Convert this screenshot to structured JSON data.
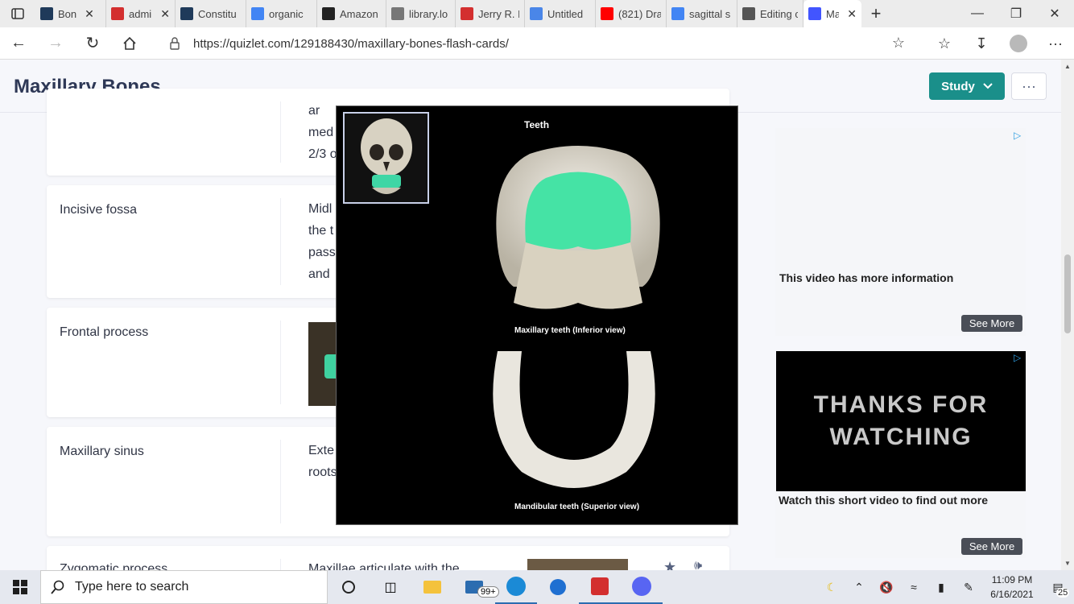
{
  "browser": {
    "tabs": [
      {
        "label": "Bon",
        "icon": "quizlet-dark-icon",
        "color": "#1f3a5a",
        "closable": true
      },
      {
        "label": "admin_a",
        "icon": "pdf-icon",
        "color": "#d32f2f",
        "closable": true
      },
      {
        "label": "Constitu",
        "icon": "quizlet-dark-icon",
        "color": "#1f3a5a",
        "closable": false
      },
      {
        "label": "organic",
        "icon": "google-icon",
        "color": "#4285f4",
        "closable": false
      },
      {
        "label": "Amazon",
        "icon": "amazon-icon",
        "color": "#222222",
        "closable": false
      },
      {
        "label": "library.lo",
        "icon": "page-icon",
        "color": "#777777",
        "closable": false
      },
      {
        "label": "Jerry R. M",
        "icon": "pdf-icon",
        "color": "#d32f2f",
        "closable": false
      },
      {
        "label": "Untitled",
        "icon": "docs-icon",
        "color": "#4a86e8",
        "closable": false
      },
      {
        "label": "(821) Dra",
        "icon": "youtube-icon",
        "color": "#ff0000",
        "closable": false
      },
      {
        "label": "sagittal s",
        "icon": "google-icon",
        "color": "#4285f4",
        "closable": false
      },
      {
        "label": "Editing c",
        "icon": "edit-icon",
        "color": "#555555",
        "closable": false
      },
      {
        "label": "Max",
        "icon": "quizlet-icon",
        "color": "#4255ff",
        "closable": true,
        "active": true
      }
    ],
    "url": "https://quizlet.com/129188430/maxillary-bones-flash-cards/"
  },
  "page": {
    "title": "Maxillary Bones",
    "study_label": "Study",
    "more_label": "···"
  },
  "cards": [
    {
      "term": "",
      "def_lines": [
        "ar",
        "med",
        "2/3 o"
      ]
    },
    {
      "term": "Incisive fossa",
      "def_lines": [
        "Midl",
        "the t",
        "pass",
        "and"
      ]
    },
    {
      "term": "Frontal process",
      "def_lines": []
    },
    {
      "term": "Maxillary sinus",
      "def_lines": [
        "Exte",
        "roots"
      ]
    },
    {
      "term": "Zygomatic process",
      "def_lines": [
        "Maxillae articulate with the"
      ]
    }
  ],
  "modal": {
    "title": "Teeth",
    "caption_upper": "Maxillary teeth (Inferior view)",
    "caption_lower": "Mandibular teeth (Superior view)"
  },
  "ads": {
    "ad1_text": "This video has more information",
    "ad1_button": "See More",
    "ad2_video_line1": "THANKS FOR",
    "ad2_video_line2": "WATCHING",
    "ad2_text": "Watch this short video to find out more",
    "ad2_button": "See More"
  },
  "taskbar": {
    "search_placeholder": "Type here to search",
    "mail_badge": "99+",
    "notif_badge": "25",
    "time": "11:09 PM",
    "date": "6/16/2021"
  }
}
